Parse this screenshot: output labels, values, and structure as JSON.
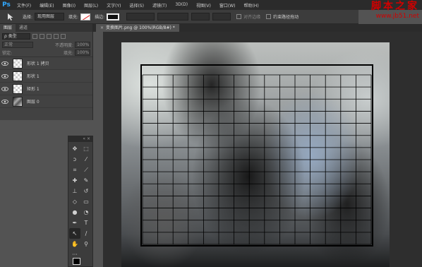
{
  "app": {
    "logo": "Ps",
    "accent": "#31a8ff"
  },
  "menu": [
    "文件(F)",
    "编辑(E)",
    "图像(I)",
    "图层(L)",
    "文字(Y)",
    "选择(S)",
    "滤镜(T)",
    "3D(D)",
    "视图(V)",
    "窗口(W)",
    "帮助(H)"
  ],
  "watermark": {
    "title": "脚本之家",
    "url": "www.jb51.net",
    "color": "#d00000"
  },
  "options": {
    "select_label": "选择:",
    "select_value": "现用图层",
    "fill_label": "填充:",
    "stroke_label": "描边:",
    "align_label": "对齐边缘",
    "constrain_label": "约束路径拖动"
  },
  "panels": {
    "tabs": [
      "图层",
      "通道"
    ],
    "kind": "ρ 类型",
    "blend": "正常",
    "opacity_label": "不透明度:",
    "opacity_value": "100%",
    "lock_label": "锁定:",
    "fill_label": "填充:",
    "fill_value": "100%"
  },
  "layers": [
    {
      "name": "形状 1 拷贝",
      "thumb": "transparent"
    },
    {
      "name": "形状 1",
      "thumb": "transparent"
    },
    {
      "name": "矩形 1",
      "thumb": "transparent"
    },
    {
      "name": "图层 0",
      "thumb": "image"
    }
  ],
  "tools_header": "« ×",
  "tools": [
    {
      "name": "move-icon",
      "glyph": "✥"
    },
    {
      "name": "marquee-icon",
      "glyph": "⬚"
    },
    {
      "name": "lasso-icon",
      "glyph": "ↄ"
    },
    {
      "name": "magic-wand-icon",
      "glyph": "⁄"
    },
    {
      "name": "crop-icon",
      "glyph": "⌗"
    },
    {
      "name": "eyedropper-icon",
      "glyph": "⟋"
    },
    {
      "name": "healing-icon",
      "glyph": "✚"
    },
    {
      "name": "brush-icon",
      "glyph": "✎"
    },
    {
      "name": "stamp-icon",
      "glyph": "⊥"
    },
    {
      "name": "history-brush-icon",
      "glyph": "↺"
    },
    {
      "name": "eraser-icon",
      "glyph": "◇"
    },
    {
      "name": "gradient-icon",
      "glyph": "▭"
    },
    {
      "name": "blur-icon",
      "glyph": "●"
    },
    {
      "name": "dodge-icon",
      "glyph": "◔"
    },
    {
      "name": "pen-icon",
      "glyph": "✒"
    },
    {
      "name": "type-icon",
      "glyph": "T"
    },
    {
      "name": "path-select-icon",
      "glyph": "↖"
    },
    {
      "name": "line-icon",
      "glyph": "∕"
    },
    {
      "name": "hand-icon",
      "glyph": "✋"
    },
    {
      "name": "zoom-icon",
      "glyph": "⚲"
    },
    {
      "name": "more-icon",
      "glyph": "···"
    },
    {
      "name": "blank",
      "glyph": ""
    }
  ],
  "document": {
    "tab_title": "变换图片.png @ 100%(RGB/8#) *",
    "close": "×"
  },
  "grid": {
    "columns": 15,
    "rows": 14
  }
}
